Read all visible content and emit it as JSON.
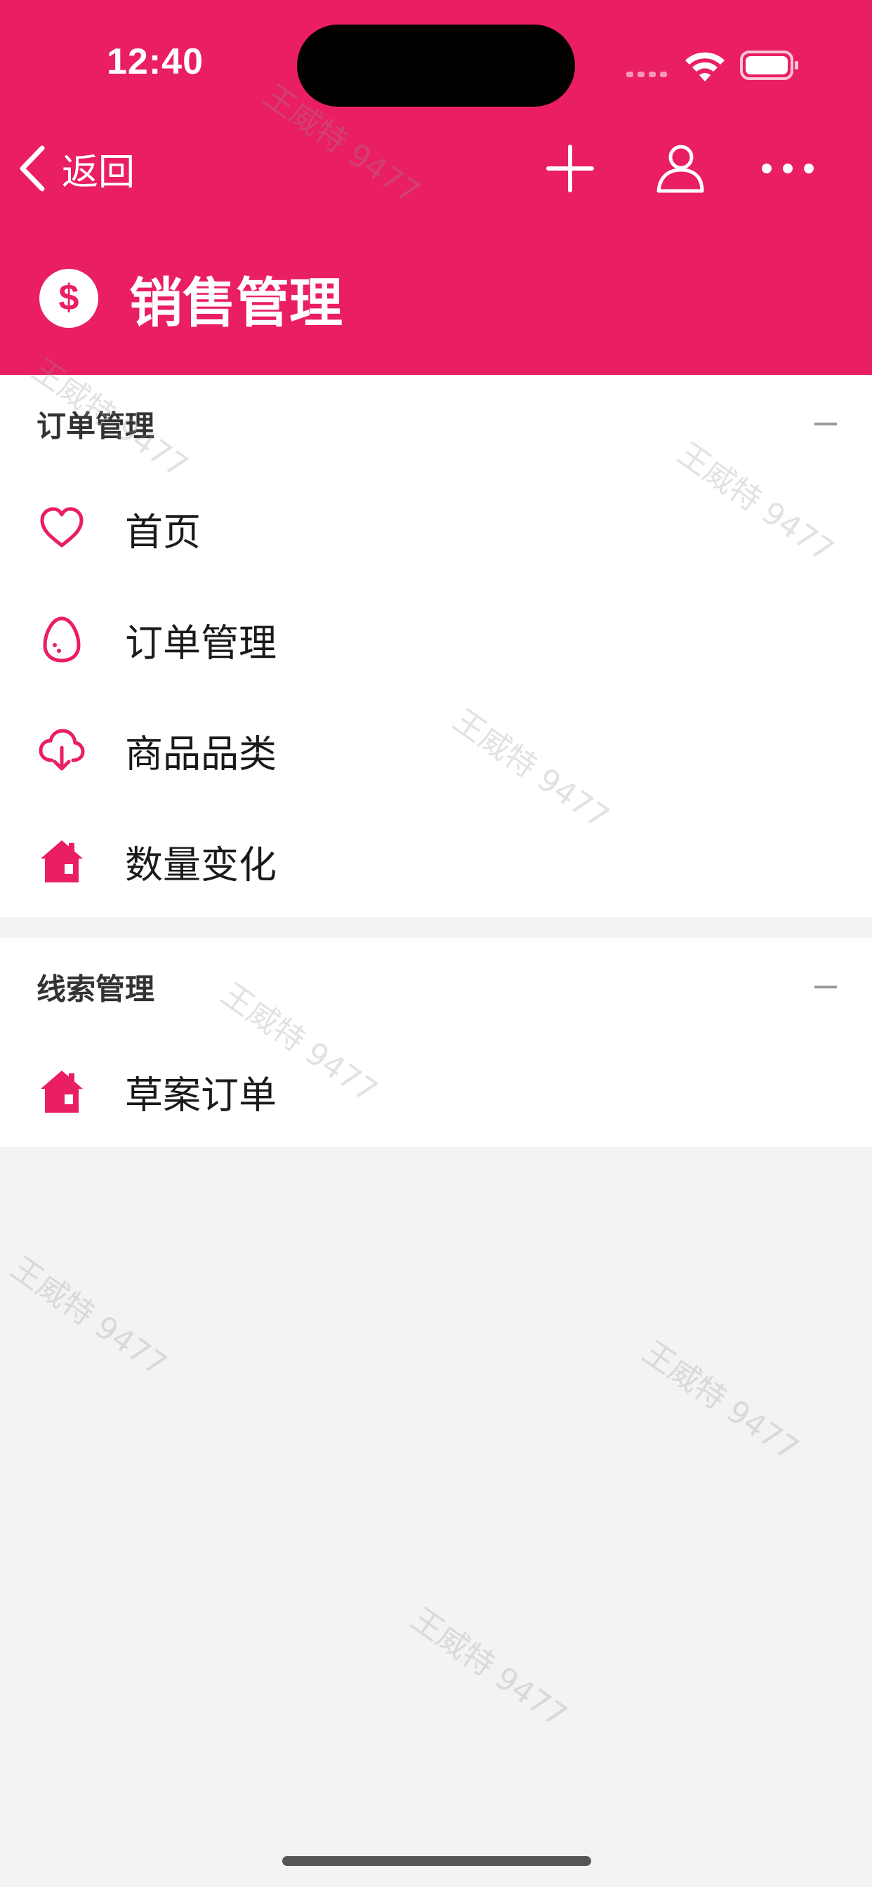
{
  "status_bar": {
    "time": "12:40"
  },
  "nav": {
    "back_label": "返回"
  },
  "header": {
    "title": "销售管理"
  },
  "sections": [
    {
      "title": "订单管理",
      "items": [
        {
          "label": "首页",
          "icon": "heart-icon"
        },
        {
          "label": "订单管理",
          "icon": "egg-icon"
        },
        {
          "label": "商品品类",
          "icon": "cloud-download-icon"
        },
        {
          "label": "数量变化",
          "icon": "home-icon"
        }
      ]
    },
    {
      "title": "线索管理",
      "items": [
        {
          "label": "草案订单",
          "icon": "home-icon"
        }
      ]
    }
  ],
  "watermark": "王威特 9477",
  "colors": {
    "accent": "#e91e63",
    "background": "#f2f3f5"
  }
}
